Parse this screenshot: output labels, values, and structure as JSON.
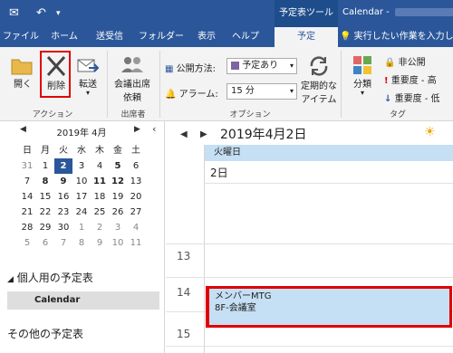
{
  "window": {
    "context_tab_title": "予定表ツール",
    "title": "Calendar - "
  },
  "ribbon_tabs": [
    "ファイル",
    "ホーム",
    "送受信",
    "フォルダー",
    "表示",
    "ヘルプ",
    "予定"
  ],
  "search_hint": "実行したい作業を入力し",
  "ribbon": {
    "open_label": "開く",
    "delete_label": "削除",
    "forward_label": "転送",
    "meeting_label_1": "会議出席",
    "meeting_label_2": "依頼",
    "publish_label": "公開方法:",
    "publish_value": "予定あり",
    "alarm_label": "アラーム:",
    "alarm_value": "15 分",
    "recurring_label_1": "定期的な",
    "recurring_label_2": "アイテム",
    "categorize_label": "分類",
    "private_label": "非公開",
    "high_importance_label": "重要度 - 高",
    "low_importance_label": "重要度 - 低",
    "groups": {
      "actions": "アクション",
      "attendees": "出席者",
      "options": "オプション",
      "tags": "タグ"
    }
  },
  "mini_calendar": {
    "month_label": "2019年 4月",
    "weekdays": [
      "日",
      "月",
      "火",
      "水",
      "木",
      "金",
      "土"
    ],
    "weeks": [
      [
        "31",
        "1",
        "2",
        "3",
        "4",
        "5",
        "6"
      ],
      [
        "7",
        "8",
        "9",
        "10",
        "11",
        "12",
        "13"
      ],
      [
        "14",
        "15",
        "16",
        "17",
        "18",
        "19",
        "20"
      ],
      [
        "21",
        "22",
        "23",
        "24",
        "25",
        "26",
        "27"
      ],
      [
        "28",
        "29",
        "30",
        "1",
        "2",
        "3",
        "4"
      ],
      [
        "5",
        "6",
        "7",
        "8",
        "9",
        "10",
        "11"
      ]
    ]
  },
  "nav": {
    "my_calendars": "個人用の予定表",
    "calendar_item": "Calendar",
    "other_calendars": "その他の予定表"
  },
  "main": {
    "date_title": "2019年4月2日",
    "day_header": "火曜日",
    "day_number": "2日",
    "hours": [
      "13",
      "14",
      "15"
    ],
    "appointment": {
      "title": "メンバーMTG",
      "location": "8F-会議室"
    }
  },
  "colors": {
    "accent": "#2b579a",
    "highlight": "#e00000",
    "appointment_bg": "#c5dff5"
  }
}
